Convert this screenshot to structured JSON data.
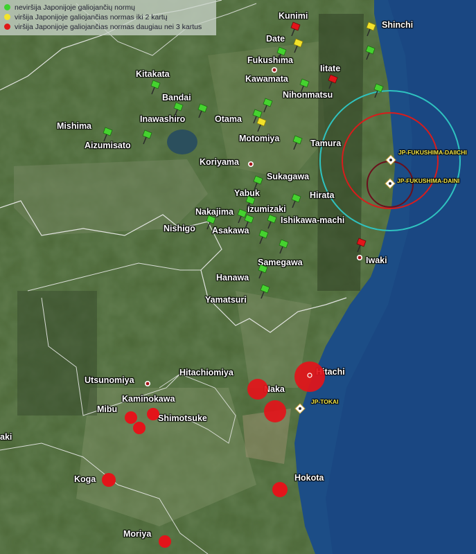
{
  "legend": [
    {
      "label": "neviršija Japonijoje galiojančių normų",
      "color": "#3fd12f"
    },
    {
      "label": "viršija Japonijoje galiojančias normas iki 2 kartų",
      "color": "#f3e42a"
    },
    {
      "label": "viršija Japonijoje galiojančias normas daugiau nei 3 kartus",
      "color": "#e01818"
    }
  ],
  "colors": {
    "green": "#45d22f",
    "yellow": "#f2e22a",
    "red": "#e3141a",
    "sea": "#1c4d86",
    "ring_outer": "#2fc3c0",
    "ring_mid": "#d81c1c",
    "ring_inner": "#6a0f1c"
  },
  "labels": [
    {
      "text": "Kunimi",
      "name": "kunimi"
    },
    {
      "text": "Shinchi",
      "name": "shinchi"
    },
    {
      "text": "Date",
      "name": "date"
    },
    {
      "text": "Fukushima",
      "name": "fukushima"
    },
    {
      "text": "Iitate",
      "name": "iitate"
    },
    {
      "text": "Kawamata",
      "name": "kawamata"
    },
    {
      "text": "Kitakata",
      "name": "kitakata"
    },
    {
      "text": "Bandai",
      "name": "bandai"
    },
    {
      "text": "Nihonmatsu",
      "name": "nihonmatsu"
    },
    {
      "text": "Inawashiro",
      "name": "inawashiro"
    },
    {
      "text": "Otama",
      "name": "otama"
    },
    {
      "text": "Mishima",
      "name": "mishima"
    },
    {
      "text": "Motomiya",
      "name": "motomiya"
    },
    {
      "text": "Tamura",
      "name": "tamura"
    },
    {
      "text": "Aizumisato",
      "name": "aizumisato"
    },
    {
      "text": "Koriyama",
      "name": "koriyama"
    },
    {
      "text": "JP-FUKUSHIMA-DAIICHI",
      "name": "daiichi"
    },
    {
      "text": "Sukagawa",
      "name": "sukagawa"
    },
    {
      "text": "JP-FUKUSHIMA-DAINI",
      "name": "daini"
    },
    {
      "text": "Yabuk",
      "name": "yabuk"
    },
    {
      "text": "Hirata",
      "name": "hirata"
    },
    {
      "text": "Nakajima",
      "name": "nakajima"
    },
    {
      "text": "Izumizaki",
      "name": "izumizaki"
    },
    {
      "text": "Nishigo",
      "name": "nishigo"
    },
    {
      "text": "Ishikawa-machi",
      "name": "ishikawa-machi"
    },
    {
      "text": "Asakawa",
      "name": "asakawa"
    },
    {
      "text": "Iwaki",
      "name": "iwaki"
    },
    {
      "text": "Samegawa",
      "name": "samegawa"
    },
    {
      "text": "Hanawa",
      "name": "hanawa"
    },
    {
      "text": "Yamatsuri",
      "name": "yamatsuri"
    },
    {
      "text": "Hitachi",
      "name": "hitachi"
    },
    {
      "text": "Hitachiomiya",
      "name": "hitachiomiya"
    },
    {
      "text": "Utsunomiya",
      "name": "utsunomiya"
    },
    {
      "text": "Naka",
      "name": "naka"
    },
    {
      "text": "Kaminokawa",
      "name": "kaminokawa"
    },
    {
      "text": "JP-TOKAI",
      "name": "tokai"
    },
    {
      "text": "Mibu",
      "name": "mibu"
    },
    {
      "text": "Shimotsuke",
      "name": "shimotsuke"
    },
    {
      "text": "aki",
      "name": "aki"
    },
    {
      "text": "Koga",
      "name": "koga"
    },
    {
      "text": "Hokota",
      "name": "hokota"
    },
    {
      "text": "Moriya",
      "name": "moriya"
    }
  ]
}
